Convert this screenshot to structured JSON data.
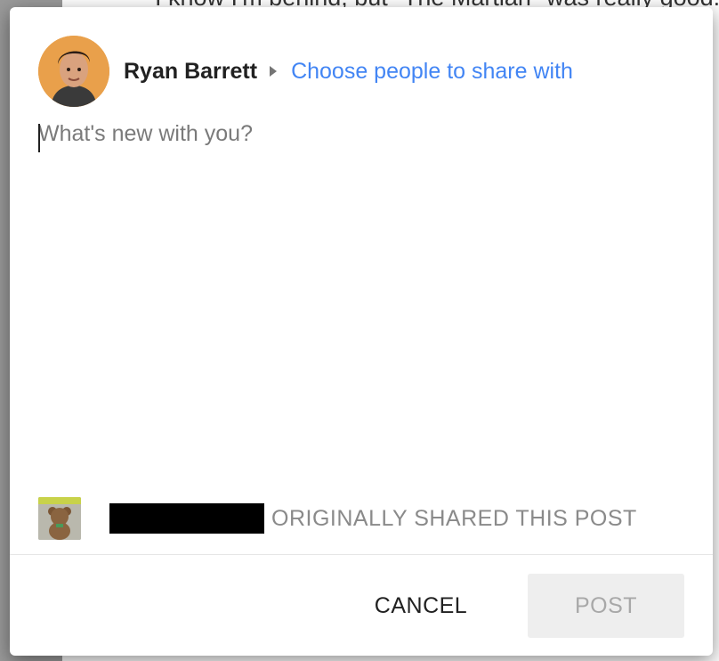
{
  "background": {
    "text": "I know I'm behind, but \"The Martian\" was really good."
  },
  "dialog": {
    "author_name": "Ryan Barrett",
    "share_link": "Choose people to share with",
    "composer_placeholder": "What's new with you?",
    "reshare_note": "ORIGINALLY SHARED THIS POST",
    "cancel_label": "CANCEL",
    "post_label": "POST"
  },
  "colors": {
    "link": "#4285f4",
    "disabled_button_bg": "#eeeeee",
    "disabled_button_text": "#a8a8a8"
  }
}
